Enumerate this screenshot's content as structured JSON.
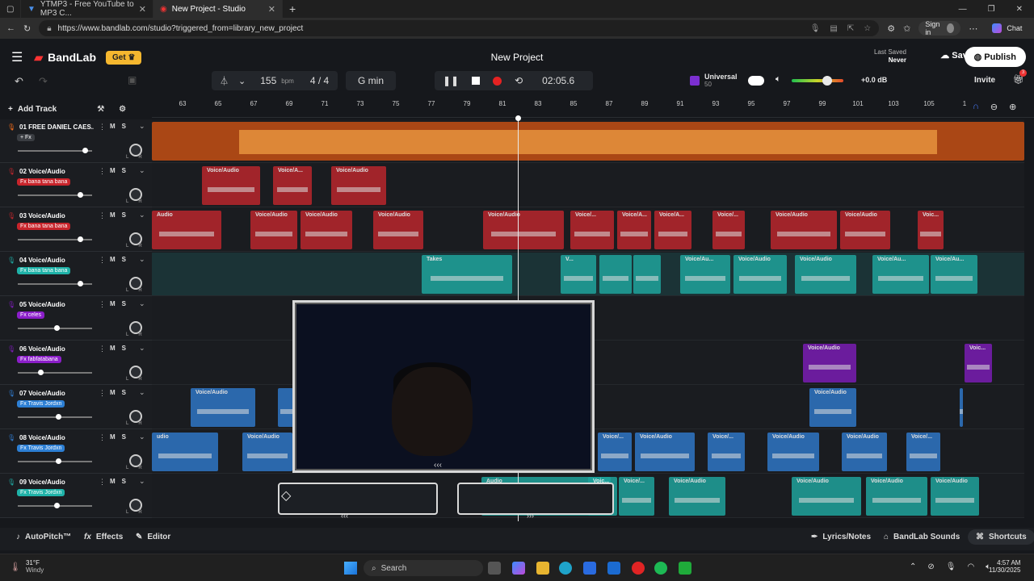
{
  "browser": {
    "tabs": [
      {
        "label": "YTMP3 - Free YouTube to MP3 C...",
        "active": false
      },
      {
        "label": "New Project - Studio",
        "active": true
      }
    ],
    "url": "https://www.bandlab.com/studio?triggered_from=library_new_project",
    "signin": "Sign in",
    "chat": "Chat"
  },
  "app": {
    "brand": "BandLab",
    "get_label": "Get",
    "project_title": "New Project",
    "last_saved_label": "Last Saved",
    "last_saved_value": "Never",
    "save_label": "Save",
    "publish_label": "Publish",
    "invite_label": "Invite",
    "notification_count": "3"
  },
  "toolbar": {
    "bpm_value": "155",
    "bpm_unit": "bpm",
    "time_sig": "4 / 4",
    "key": "G min",
    "time": "02:05.6",
    "preset_name": "Universal",
    "preset_sub": "50",
    "master_db": "+0.0 dB"
  },
  "tracks_header": {
    "add_track": "Add Track"
  },
  "ruler": [
    "63",
    "65",
    "67",
    "69",
    "71",
    "73",
    "75",
    "77",
    "79",
    "81",
    "83",
    "85",
    "87",
    "89",
    "91",
    "93",
    "95",
    "97",
    "99",
    "101",
    "103",
    "105",
    "1"
  ],
  "tracks": [
    {
      "num": "01",
      "name": "FREE DANIEL CAES...",
      "fx": "+ Fx",
      "fx_color": "#3a3d42",
      "color": "#ef6b1a",
      "volume": 0.94
    },
    {
      "num": "02",
      "name": "Voice/Audio",
      "fx": "Fx bana tana bana",
      "fx_color": "#c8242b",
      "color": "#b9262c",
      "volume": 0.87
    },
    {
      "num": "03",
      "name": "Voice/Audio",
      "fx": "Fx bana tana bana",
      "fx_color": "#c8242b",
      "color": "#b9262c",
      "volume": 0.87
    },
    {
      "num": "04",
      "name": "Voice/Audio",
      "fx": "Fx bana tana bana",
      "fx_color": "#1fb2a8",
      "color": "#1fa39c",
      "volume": 0.87
    },
    {
      "num": "05",
      "name": "Voice/Audio",
      "fx": "Fx celes",
      "fx_color": "#8b1ec9",
      "color": "#7a1db3",
      "volume": 0.53
    },
    {
      "num": "06",
      "name": "Voice/Audio",
      "fx": "Fx fabfatabana",
      "fx_color": "#8b1ec9",
      "color": "#7a1db3",
      "volume": 0.29
    },
    {
      "num": "07",
      "name": "Voice/Audio",
      "fx": "Fx Travis Jordxn",
      "fx_color": "#2d7fd4",
      "color": "#2f76c5",
      "volume": 0.55
    },
    {
      "num": "08",
      "name": "Voice/Audio",
      "fx": "Fx Travis Jordxn",
      "fx_color": "#2d7fd4",
      "color": "#2f76c5",
      "volume": 0.55
    },
    {
      "num": "09",
      "name": "Voice/Audio",
      "fx": "Fx Travis Jordxn",
      "fx_color": "#1fb2a8",
      "color": "#1fa39c",
      "volume": 0.53
    }
  ],
  "clip_labels": {
    "voice": "Voice/Audio",
    "voice_short": "Voice/A...",
    "voice_short2": "Voice/...",
    "audio": "Audio",
    "udio": "udio",
    "takes": "Takes",
    "voi": "Voic...",
    "v_dots": "V...",
    "voice_au": "Voice/Au..."
  },
  "bottom": {
    "autopitch": "AutoPitch™",
    "effects": "Effects",
    "editor": "Editor",
    "lyrics": "Lyrics/Notes",
    "sounds": "BandLab Sounds",
    "shortcuts": "Shortcuts"
  },
  "taskbar": {
    "weather_temp": "31°F",
    "weather_desc": "Windy",
    "search": "Search",
    "time": "4:57 AM",
    "date": "11/30/2025"
  }
}
